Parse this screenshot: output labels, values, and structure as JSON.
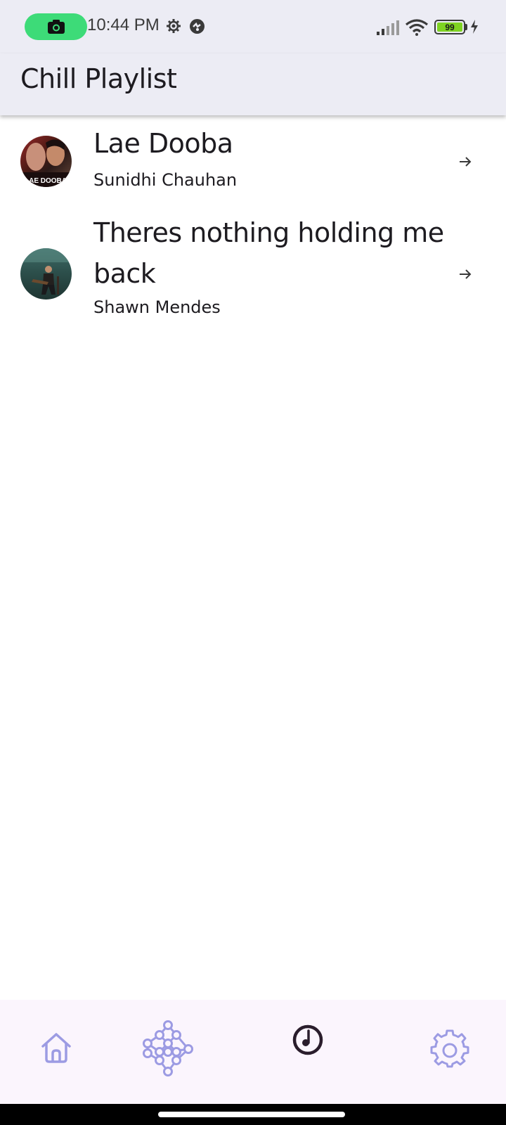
{
  "status_bar": {
    "time": "10:44 PM",
    "battery": "99",
    "icons": [
      "screen-record-icon",
      "gear-icon",
      "vpn-icon",
      "signal-icon",
      "wifi-icon",
      "battery-icon",
      "charging-icon"
    ]
  },
  "app_bar": {
    "title": "Chill Playlist"
  },
  "playlist": {
    "items": [
      {
        "title": "Lae Dooba",
        "artist": "Sunidhi Chauhan",
        "art_caption": "LAE DOOBA"
      },
      {
        "title": "Theres nothing holding me back",
        "artist": "Shawn Mendes"
      }
    ]
  },
  "bottom_nav": {
    "items": [
      "home-icon",
      "network-icon",
      "music-icon",
      "settings-icon"
    ],
    "active": "music-icon",
    "colors": {
      "inactive": "#9c9be3",
      "active": "#2a1d2c"
    }
  },
  "colors": {
    "bar_bg": "#ececf4",
    "record_pill": "#3ddb78",
    "battery_fill": "#7ed321"
  }
}
